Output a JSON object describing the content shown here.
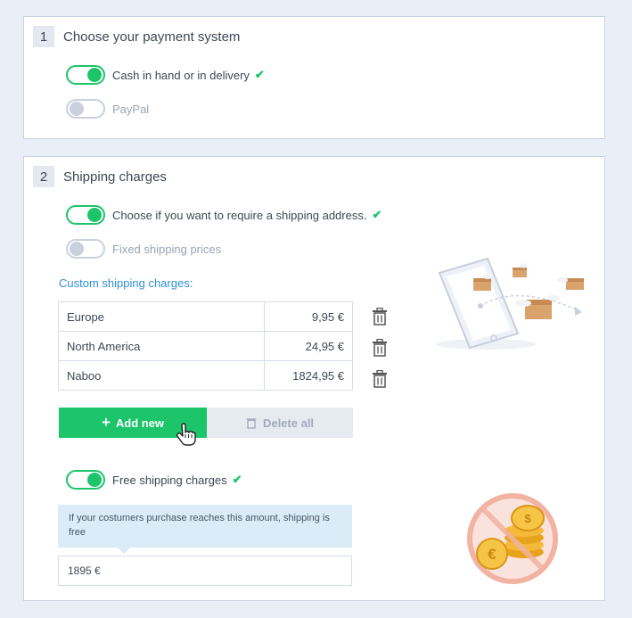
{
  "colors": {
    "accent": "#1cc46a",
    "link": "#2f8fd6",
    "background": "#e9eef7"
  },
  "payment": {
    "number": "1",
    "title": "Choose your payment system",
    "options": [
      {
        "label": "Cash in hand or in delivery",
        "enabled": true
      },
      {
        "label": "PayPal",
        "enabled": false
      }
    ]
  },
  "shipping": {
    "number": "2",
    "title": "Shipping charges",
    "options": [
      {
        "label": "Choose if you want to require a shipping address.",
        "enabled": true
      },
      {
        "label": "Fixed shipping prices",
        "enabled": false
      }
    ],
    "custom_label": "Custom shipping charges:",
    "charges": [
      {
        "region": "Europe",
        "amount": "9,95 €"
      },
      {
        "region": "North America",
        "amount": "24,95 €"
      },
      {
        "region": "Naboo",
        "amount": "1824,95 €"
      }
    ],
    "add_label": "Add new",
    "delete_all_label": "Delete all",
    "free_shipping": {
      "label": "Free shipping charges",
      "enabled": true
    },
    "info_text": "If your costumers purchase reaches this amount, shipping is free",
    "threshold_value": "1895 €"
  },
  "icons": [
    "check-icon",
    "trash-icon",
    "plus-icon",
    "hand-cursor-icon",
    "delivery-illustration",
    "no-coins-illustration"
  ]
}
